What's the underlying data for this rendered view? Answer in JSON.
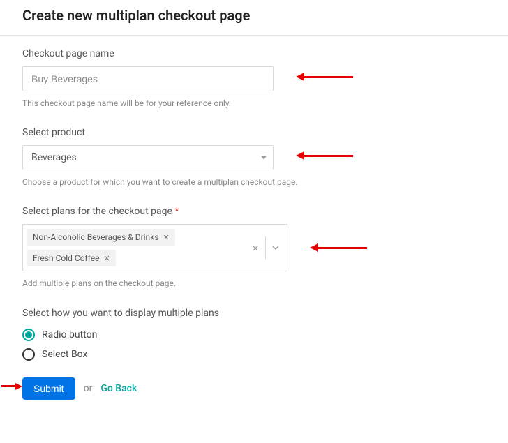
{
  "header": {
    "title": "Create new multiplan checkout page"
  },
  "field_name": {
    "label": "Checkout page name",
    "value": "Buy Beverages",
    "hint": "This checkout page name will be for your reference only."
  },
  "field_product": {
    "label": "Select product",
    "value": "Beverages",
    "hint": "Choose a product for which you want to create a multiplan checkout page."
  },
  "field_plans": {
    "label": "Select plans for the checkout page",
    "chips": [
      "Non-Alcoholic Beverages & Drinks",
      "Fresh Cold Coffee"
    ],
    "hint": "Add multiple plans on the checkout page."
  },
  "field_display": {
    "label": "Select how you want to display multiple plans",
    "options": [
      "Radio button",
      "Select Box"
    ],
    "selected": 0
  },
  "actions": {
    "submit": "Submit",
    "or": "or",
    "back": "Go Back"
  }
}
